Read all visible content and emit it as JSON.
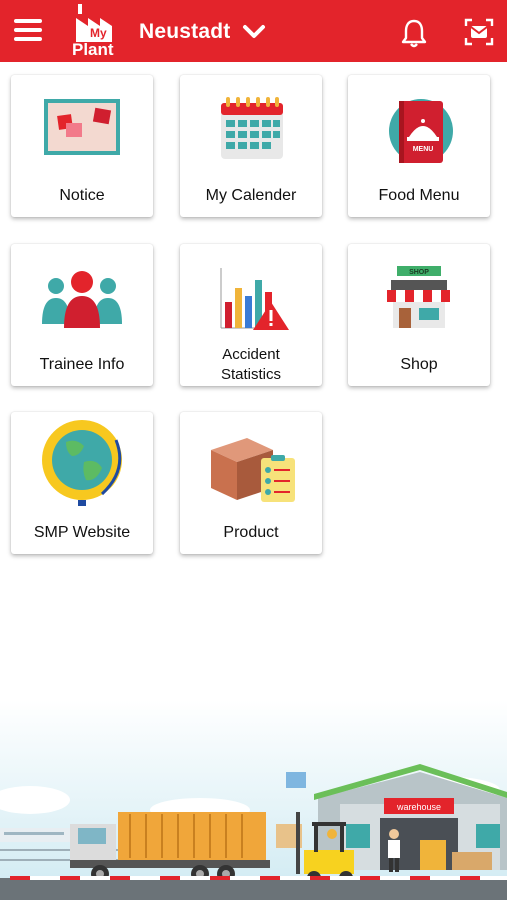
{
  "header": {
    "logo_text_top": "My",
    "logo_text_bottom": "Plant",
    "location": "Neustadt"
  },
  "tiles": [
    {
      "label": "Notice",
      "icon": "notice-board-icon"
    },
    {
      "label": "My Calender",
      "icon": "calendar-icon"
    },
    {
      "label": "Food Menu",
      "icon": "food-menu-icon"
    },
    {
      "label": "Trainee Info",
      "icon": "trainees-icon"
    },
    {
      "label_line1": "Accident",
      "label_line2": "Statistics",
      "icon": "accident-chart-icon"
    },
    {
      "label": "Shop",
      "icon": "shop-icon"
    },
    {
      "label": "SMP Website",
      "icon": "globe-icon"
    },
    {
      "label": "Product",
      "icon": "product-box-icon"
    }
  ],
  "illustration": {
    "warehouse_sign": "warehouse",
    "shop_sign": "SHOP",
    "menu_sign": "MENU"
  },
  "colors": {
    "brand_red": "#e3242b",
    "background": "#ffffff"
  }
}
